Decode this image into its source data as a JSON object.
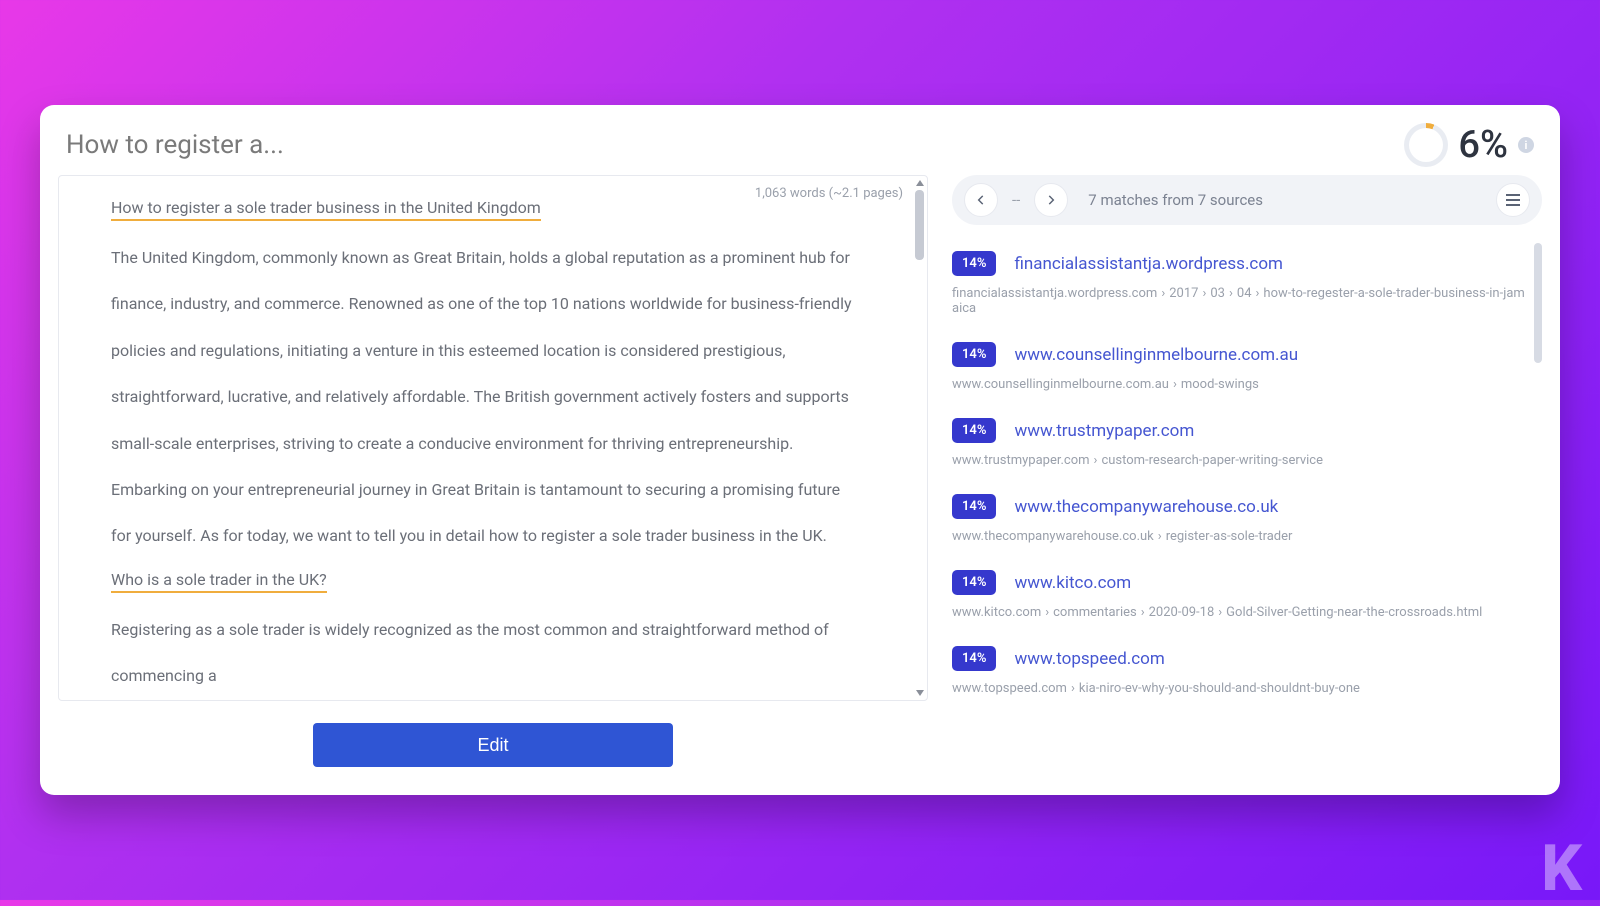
{
  "header": {
    "doc_title": "How to register a...",
    "score_percent": "6%",
    "info_icon_glyph": "i"
  },
  "editor": {
    "word_count": "1,063 words (~2.1 pages)",
    "title_underlined": "How to register a sole trader business in the United Kingdom",
    "paragraph": "The United Kingdom, commonly known as Great Britain, holds a global reputation as a prominent hub for finance, industry, and commerce. Renowned as one of the top 10 nations worldwide for business-friendly policies and regulations, initiating a venture in this esteemed location is considered prestigious, straightforward, lucrative, and relatively affordable. The British government actively fosters and supports small-scale enterprises, striving to create a conducive environment for thriving entrepreneurship. Embarking on your entrepreneurial journey in Great Britain is tantamount to securing a promising future for yourself. As for today, we want to tell you in detail how to register a sole trader business in the UK.",
    "subheading_underlined": "Who is a sole trader in the UK?",
    "paragraph2": "Registering as a sole trader is widely recognized as the most common and straightforward method of commencing a",
    "edit_button": "Edit"
  },
  "sources": {
    "nav_placeholder": "--",
    "matches_summary": "7 matches from 7 sources",
    "items": [
      {
        "pct": "14%",
        "domain": "financialassistantja.wordpress.com",
        "crumbs": [
          "financialassistantja.wordpress.com",
          "2017",
          "03",
          "04",
          "how-to-regester-a-sole-trader-business-in-jamaica"
        ]
      },
      {
        "pct": "14%",
        "domain": "www.counsellinginmelbourne.com.au",
        "crumbs": [
          "www.counsellinginmelbourne.com.au",
          "mood-swings"
        ]
      },
      {
        "pct": "14%",
        "domain": "www.trustmypaper.com",
        "crumbs": [
          "www.trustmypaper.com",
          "custom-research-paper-writing-service"
        ]
      },
      {
        "pct": "14%",
        "domain": "www.thecompanywarehouse.co.uk",
        "crumbs": [
          "www.thecompanywarehouse.co.uk",
          "register-as-sole-trader"
        ]
      },
      {
        "pct": "14%",
        "domain": "www.kitco.com",
        "crumbs": [
          "www.kitco.com",
          "commentaries",
          "2020-09-18",
          "Gold-Silver-Getting-near-the-crossroads.html"
        ]
      },
      {
        "pct": "14%",
        "domain": "www.topspeed.com",
        "crumbs": [
          "www.topspeed.com",
          "kia-niro-ev-why-you-should-and-shouldnt-buy-one"
        ]
      }
    ]
  },
  "watermark": "K"
}
